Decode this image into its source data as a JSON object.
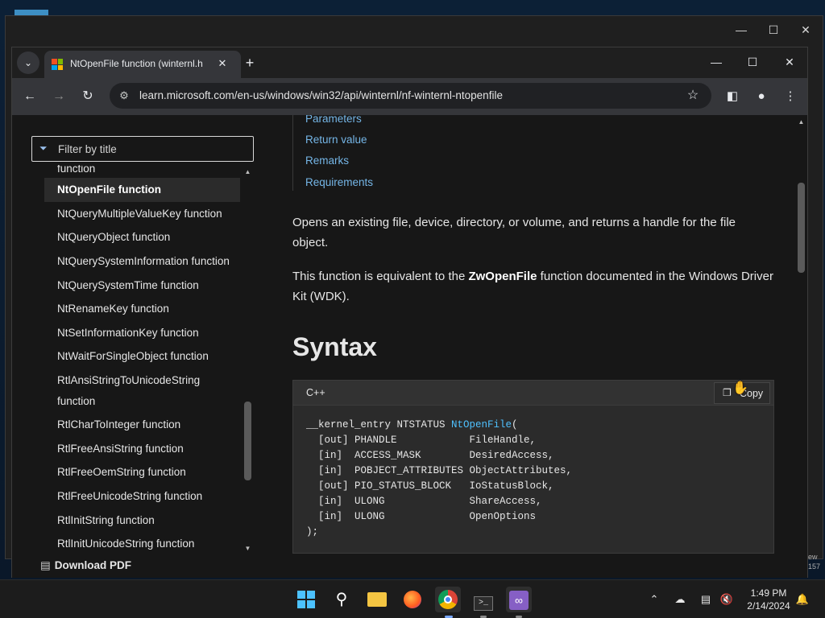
{
  "browser": {
    "tab_title": "NtOpenFile function (winternl.h",
    "url": "learn.microsoft.com/en-us/windows/win32/api/winternl/nf-winternl-ntopenfile"
  },
  "sidebar": {
    "filter_placeholder": "Filter by title",
    "partial_item": "function",
    "items": [
      {
        "label": "NtOpenFile function",
        "active": true
      },
      {
        "label": "NtQueryMultipleValueKey function"
      },
      {
        "label": "NtQueryObject function"
      },
      {
        "label": "NtQuerySystemInformation function"
      },
      {
        "label": "NtQuerySystemTime function"
      },
      {
        "label": "NtRenameKey function"
      },
      {
        "label": "NtSetInformationKey function"
      },
      {
        "label": "NtWaitForSingleObject function"
      },
      {
        "label": "RtlAnsiStringToUnicodeString"
      },
      {
        "label": "function"
      },
      {
        "label": "RtlCharToInteger function"
      },
      {
        "label": "RtlFreeAnsiString function"
      },
      {
        "label": "RtlFreeOemString function"
      },
      {
        "label": "RtlFreeUnicodeString function"
      },
      {
        "label": "RtlInitString function"
      },
      {
        "label": "RtlInitUnicodeString function"
      }
    ],
    "download_pdf": "Download PDF"
  },
  "article": {
    "toc_links": [
      "Parameters",
      "Return value",
      "Remarks",
      "Requirements"
    ],
    "intro": "Opens an existing file, device, directory, or volume, and returns a handle for the file object.",
    "equiv_pre": "This function is equivalent to the ",
    "equiv_bold": "ZwOpenFile",
    "equiv_post": " function documented in the Windows Driver Kit (WDK).",
    "syntax_heading": "Syntax",
    "code_lang": "C++",
    "copy_label": "Copy",
    "code": {
      "line1_pre": "__kernel_entry NTSTATUS ",
      "line1_fn": "NtOpenFile",
      "line1_post": "(",
      "lines": [
        "  [out] PHANDLE            FileHandle,",
        "  [in]  ACCESS_MASK        DesiredAccess,",
        "  [in]  POBJECT_ATTRIBUTES ObjectAttributes,",
        "  [out] PIO_STATUS_BLOCK   IoStatusBlock,",
        "  [in]  ULONG              ShareAccess,",
        "  [in]  ULONG              OpenOptions"
      ],
      "last": ");"
    }
  },
  "edge_text": [
    "ew",
    "157"
  ],
  "taskbar": {
    "time": "1:49 PM",
    "date": "2/14/2024"
  },
  "colors": {
    "link": "#75b6e7",
    "function_name": "#4fc1ff",
    "windows_accent": "#4cc2ff"
  }
}
